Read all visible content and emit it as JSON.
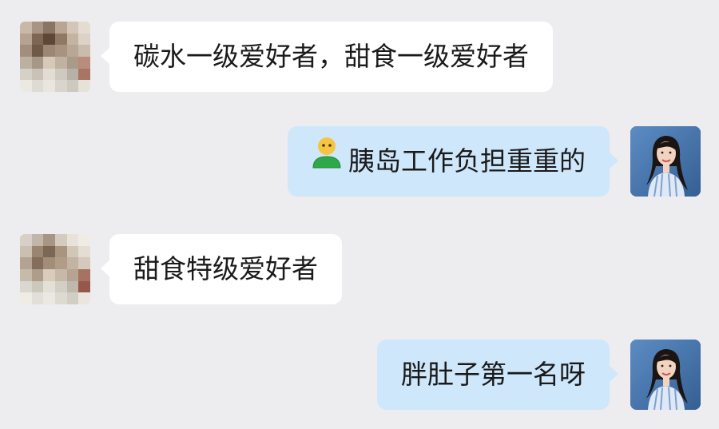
{
  "messages": [
    {
      "side": "left",
      "text": "碳水一级爱好者，甜食一级爱好者",
      "avatar": "pixelated-avatar"
    },
    {
      "side": "right",
      "emoji": "person-shrugging-green-shirt",
      "text": "胰岛工作负担重重的",
      "avatar": "woman-blue-striped-shirt"
    },
    {
      "side": "left",
      "text": "甜食特级爱好者",
      "avatar": "pixelated-avatar"
    },
    {
      "side": "right",
      "text": "胖肚子第一名呀",
      "avatar": "woman-blue-striped-shirt"
    }
  ],
  "colors": {
    "background": "#ededf0",
    "bubble_left": "#ffffff",
    "bubble_right": "#cfe7fb",
    "text": "#1a1a1a"
  }
}
